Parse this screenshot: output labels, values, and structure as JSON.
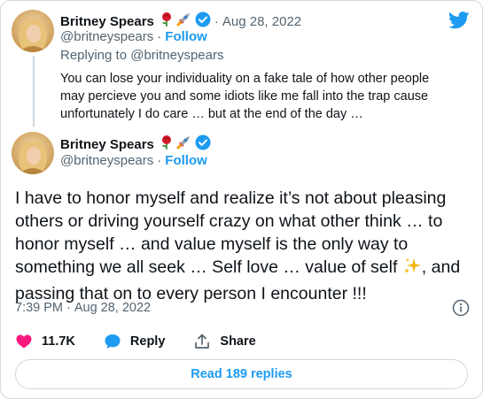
{
  "colors": {
    "accent": "#1d9bf0",
    "text": "#0f1419",
    "muted": "#536471",
    "like": "#f91880",
    "border": "#cfd9de"
  },
  "quoted_tweet": {
    "name": "Britney Spears",
    "emojis": [
      "rose-emoji",
      "rocket-emoji"
    ],
    "verified": true,
    "date": "Aug 28, 2022",
    "handle": "@britneyspears",
    "separator": "·",
    "follow_label": "Follow",
    "reply_to_prefix": "Replying to",
    "reply_to_handle": "@britneyspears",
    "text": "You can lose your individuality on a fake tale of how other people may percieve you and some idiots like me fall into the trap cause unfortunately I do care … but at the end of the day …"
  },
  "main_tweet": {
    "name": "Britney Spears",
    "emojis": [
      "rose-emoji",
      "rocket-emoji"
    ],
    "verified": true,
    "handle": "@britneyspears",
    "separator": "·",
    "follow_label": "Follow",
    "text_before_emoji": "I have to honor myself and realize it’s not about pleasing others or driving yourself crazy on what other think … to honor myself … and value myself is the only way to something we all seek … Self love … value of self",
    "inline_emoji": "sparkles-emoji",
    "text_after_emoji": ", and passing that on to every person I encounter !!!",
    "time": "7:39 PM",
    "date": "Aug 28, 2022",
    "meta_separator": "·"
  },
  "actions": {
    "like_count": "11.7K",
    "reply_label": "Reply",
    "share_label": "Share"
  },
  "read_replies_label": "Read 189 replies",
  "icons": [
    "twitter-bird-icon",
    "verified-badge-icon",
    "info-icon",
    "heart-icon",
    "reply-bubble-icon",
    "share-icon"
  ]
}
